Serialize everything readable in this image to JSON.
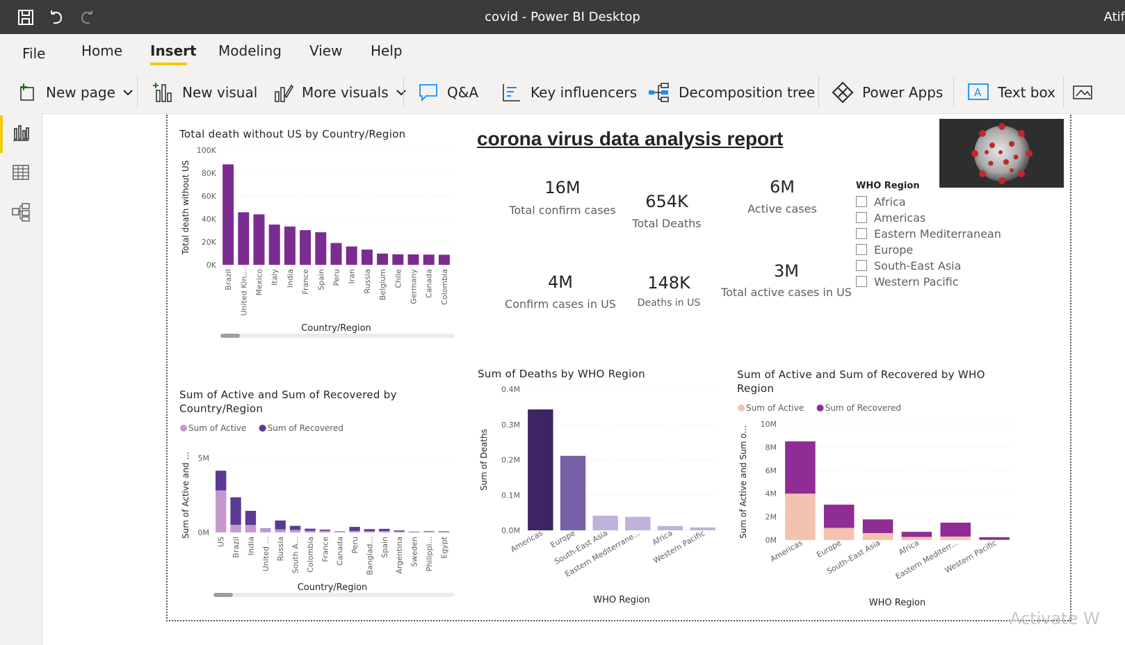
{
  "window": {
    "title": "covid - Power BI Desktop",
    "user": "Atif"
  },
  "menu": {
    "items": [
      "File",
      "Home",
      "Insert",
      "Modeling",
      "View",
      "Help"
    ],
    "active": "Insert"
  },
  "ribbon": {
    "new_page": "New page",
    "new_visual": "New visual",
    "more_visuals": "More visuals",
    "qna": "Q&A",
    "key_influencers": "Key influencers",
    "decomposition_tree": "Decomposition tree",
    "power_apps": "Power Apps",
    "text_box": "Text box"
  },
  "report": {
    "title": "corona virus data analysis report"
  },
  "cards": [
    {
      "value": "16M",
      "label": "Total confirm cases"
    },
    {
      "value": "654K",
      "label": "Total Deaths"
    },
    {
      "value": "6M",
      "label": "Active cases"
    },
    {
      "value": "4M",
      "label": "Confirm cases in US"
    },
    {
      "value": "148K",
      "label": "Deaths in US"
    },
    {
      "value": "3M",
      "label": "Total active cases in US"
    }
  ],
  "slicer": {
    "title": "WHO Region",
    "items": [
      "Africa",
      "Americas",
      "Eastern Mediterranean",
      "Europe",
      "South-East Asia",
      "Western Pacific"
    ]
  },
  "watermark": "Activate W",
  "colors": {
    "accent": "#f2c811",
    "titlebar": "#3c3b3b",
    "purple": "#7b2c91"
  },
  "chart_data": [
    {
      "type": "bar",
      "title": "Total death without US by Country/Region",
      "xlabel": "Country/Region",
      "ylabel": "Total death without US",
      "ylim": [
        0,
        100000
      ],
      "yticks": [
        "0K",
        "20K",
        "40K",
        "60K",
        "80K",
        "100K"
      ],
      "categories": [
        "Brazil",
        "United Kin...",
        "Mexico",
        "Italy",
        "India",
        "France",
        "Spain",
        "Peru",
        "Iran",
        "Russia",
        "Belgium",
        "Chile",
        "Germany",
        "Canada",
        "Colombia"
      ],
      "values": [
        87600,
        45800,
        44000,
        35100,
        33400,
        30200,
        28400,
        19000,
        16000,
        13300,
        9800,
        9200,
        9100,
        8900,
        8800
      ],
      "color": "#7b2c91"
    },
    {
      "type": "bar",
      "stacked": true,
      "title": "Sum of Active and Sum of Recovered by Country/Region",
      "xlabel": "Country/Region",
      "ylabel": "Sum of Active and ...",
      "ylim": [
        0,
        5000000
      ],
      "yticks": [
        "0M",
        "5M"
      ],
      "categories": [
        "US",
        "Brazil",
        "India",
        "United ...",
        "Russia",
        "South A...",
        "Colombia",
        "France",
        "Canada",
        "Peru",
        "Banglad...",
        "Spain",
        "Argentina",
        "Sweden",
        "Philippi...",
        "Egypt"
      ],
      "series": [
        {
          "name": "Sum of Active",
          "color": "#c498cf",
          "values": [
            2820000,
            510000,
            500000,
            250000,
            200000,
            170000,
            110000,
            110000,
            60000,
            100000,
            80000,
            90000,
            60000,
            40000,
            50000,
            30000
          ]
        },
        {
          "name": "Sum of Recovered",
          "color": "#5b3a96",
          "values": [
            1330000,
            1850000,
            950000,
            20000,
            600000,
            270000,
            140000,
            80000,
            10000,
            270000,
            140000,
            150000,
            70000,
            10000,
            30000,
            40000
          ]
        }
      ]
    },
    {
      "type": "bar",
      "title": "Sum of Deaths by WHO Region",
      "xlabel": "WHO Region",
      "ylabel": "Sum of Deaths",
      "ylim": [
        0,
        400000
      ],
      "yticks": [
        "0.0M",
        "0.1M",
        "0.2M",
        "0.3M",
        "0.4M"
      ],
      "categories": [
        "Americas",
        "Europe",
        "South-East Asia",
        "Eastern Mediterrane...",
        "Africa",
        "Western Pacific"
      ],
      "values": [
        342700,
        211200,
        41400,
        38300,
        12200,
        8200
      ],
      "colors": [
        "#3e2463",
        "#7860a4",
        "#c0b1dd",
        "#c0b1dd",
        "#c0b1dd",
        "#c0b1dd"
      ]
    },
    {
      "type": "bar",
      "stacked": true,
      "title": "Sum of Active and Sum of Recovered by WHO Region",
      "xlabel": "WHO Region",
      "ylabel": "Sum of Active and Sum o...",
      "ylim": [
        0,
        10000000
      ],
      "yticks": [
        "0M",
        "2M",
        "4M",
        "6M",
        "8M",
        "10M"
      ],
      "categories": [
        "Americas",
        "Europe",
        "South-East Asia",
        "Africa",
        "Eastern Mediterr...",
        "Western Pacific"
      ],
      "series": [
        {
          "name": "Sum of Active",
          "color": "#f4c3b0",
          "values": [
            4000000,
            1050000,
            600000,
            270000,
            300000,
            30000
          ]
        },
        {
          "name": "Sum of Recovered",
          "color": "#8f2c95",
          "values": [
            4500000,
            2000000,
            1180000,
            440000,
            1200000,
            210000
          ]
        }
      ]
    }
  ]
}
